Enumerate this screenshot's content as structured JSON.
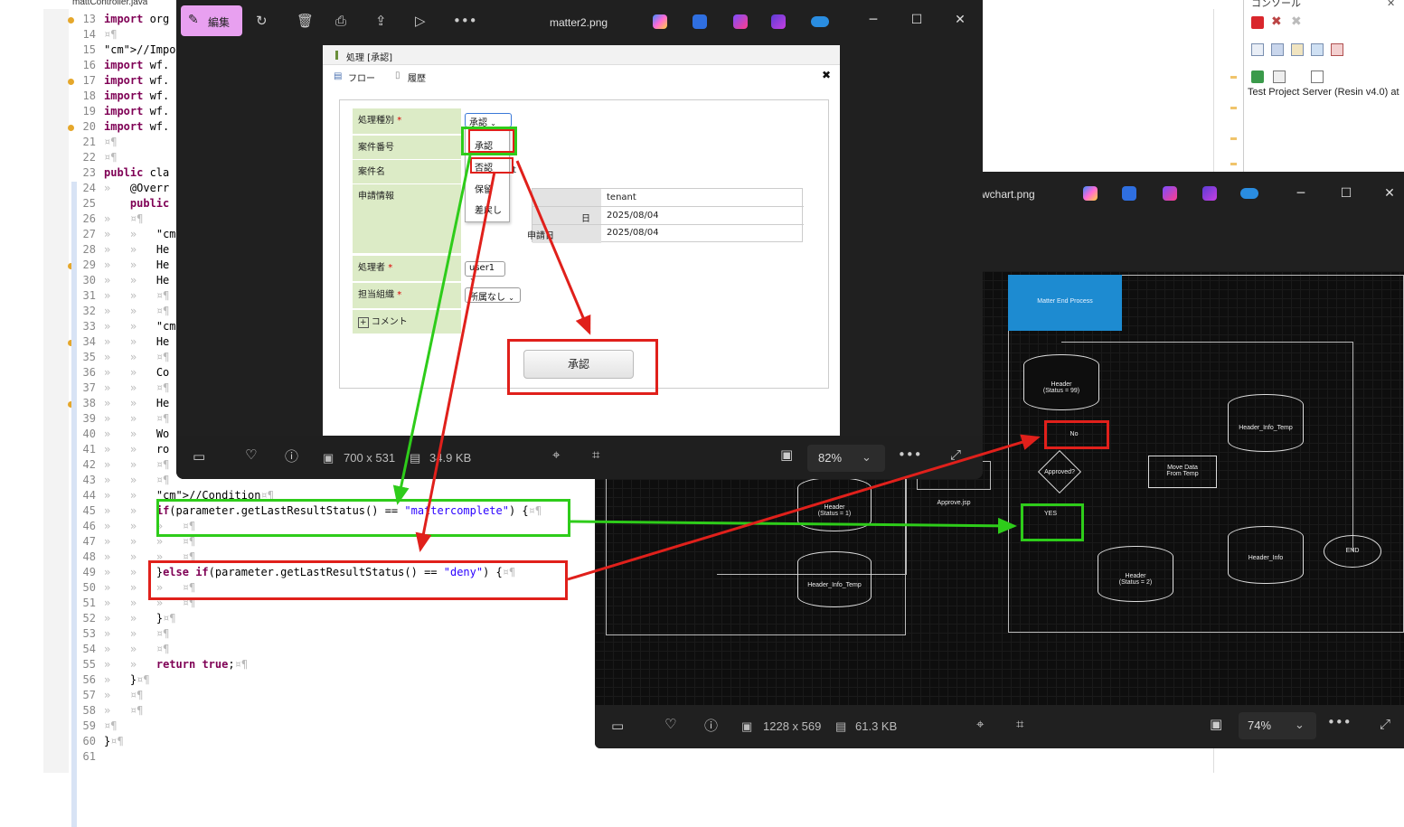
{
  "editor": {
    "tab_title": "mattController.java",
    "lines": [
      {
        "num": "13",
        "text": "import org"
      },
      {
        "num": "14",
        "text": "¤¶"
      },
      {
        "num": "15",
        "text": "//Import a"
      },
      {
        "num": "16",
        "text": "import wf."
      },
      {
        "num": "17",
        "text": "import wf."
      },
      {
        "num": "18",
        "text": "import wf."
      },
      {
        "num": "19",
        "text": "import wf."
      },
      {
        "num": "20",
        "text": "import wf."
      },
      {
        "num": "21",
        "text": "¤¶"
      },
      {
        "num": "22",
        "text": "¤¶"
      },
      {
        "num": "23",
        "text": "public cla"
      },
      {
        "num": "24",
        "text": "»   @Overr"
      },
      {
        "num": "25",
        "text": "    public"
      },
      {
        "num": "26",
        "text": "»   ¤¶"
      },
      {
        "num": "27",
        "text": "»   »   //"
      },
      {
        "num": "28",
        "text": "»   »   He"
      },
      {
        "num": "29",
        "text": "»   »   He"
      },
      {
        "num": "30",
        "text": "»   »   He"
      },
      {
        "num": "31",
        "text": "»   »   ¤¶"
      },
      {
        "num": "32",
        "text": "»   »   ¤¶"
      },
      {
        "num": "33",
        "text": "»   »   //"
      },
      {
        "num": "34",
        "text": "»   »   He"
      },
      {
        "num": "35",
        "text": "»   »   ¤¶"
      },
      {
        "num": "36",
        "text": "»   »   Co"
      },
      {
        "num": "37",
        "text": "»   »   ¤¶"
      },
      {
        "num": "38",
        "text": "»   »   He"
      },
      {
        "num": "39",
        "text": "»   »   ¤¶"
      },
      {
        "num": "40",
        "text": "»   »   Wo"
      },
      {
        "num": "41",
        "text": "»   »   ro"
      },
      {
        "num": "42",
        "text": "»   »   ¤¶"
      },
      {
        "num": "43",
        "text": "»   »   ¤¶"
      },
      {
        "num": "44",
        "text": "»   »   //Condition¤¶"
      },
      {
        "num": "45",
        "text": "»   »   if(parameter.getLastResultStatus() == \"mattercomplete\") {¤¶"
      },
      {
        "num": "46",
        "text": "»   »   »   ¤¶"
      },
      {
        "num": "47",
        "text": "»   »   »   ¤¶"
      },
      {
        "num": "48",
        "text": "»   »   »   ¤¶"
      },
      {
        "num": "49",
        "text": "»   »   }else if(parameter.getLastResultStatus() == \"deny\") {¤¶"
      },
      {
        "num": "50",
        "text": "»   »   »   ¤¶"
      },
      {
        "num": "51",
        "text": "»   »   »   ¤¶"
      },
      {
        "num": "52",
        "text": "»   »   }¤¶"
      },
      {
        "num": "53",
        "text": "»   »   ¤¶"
      },
      {
        "num": "54",
        "text": "»   »   ¤¶"
      },
      {
        "num": "55",
        "text": "»   »   return true;¤¶"
      },
      {
        "num": "56",
        "text": "»   }¤¶"
      },
      {
        "num": "57",
        "text": "»   ¤¶"
      },
      {
        "num": "58",
        "text": "»   ¤¶"
      },
      {
        "num": "59",
        "text": "¤¶"
      },
      {
        "num": "60",
        "text": "}¤¶"
      },
      {
        "num": "61",
        "text": ""
      }
    ]
  },
  "right_panel": {
    "tab_label": "コンソール",
    "server_label": "Test Project Server (Resin v4.0) at"
  },
  "viewer1": {
    "edit_label": "編集",
    "title": "matter2.png",
    "dimensions": "700 x 531",
    "filesize": "34.9 KB",
    "zoom": "82%",
    "form": {
      "header": "処理 [承認]",
      "tab_flow": "フロー",
      "tab_history": "履歴",
      "close": "✖",
      "label_type": "処理種別",
      "label_case_no": "案件番号",
      "label_case_name": "案件名",
      "label_apply": "申請情報",
      "label_processor": "処理者",
      "label_org": "担当組織",
      "label_comment": "コメント",
      "type_value": "承認",
      "dropdown_options": [
        "承認",
        "否認",
        "保留",
        "差戻し"
      ],
      "case_name_tail": "t",
      "apply_rows": [
        {
          "label": "",
          "value": "tenant"
        },
        {
          "label": "日",
          "value": "2025/08/04"
        },
        {
          "label": "申請日",
          "value": "2025/08/04"
        }
      ],
      "processor_value": "user1",
      "org_value": "所属なし",
      "submit": "承認",
      "required_mark": "*"
    }
  },
  "viewer2": {
    "title": "wchart.png",
    "dimensions": "1228 x 569",
    "filesize": "61.3 KB",
    "zoom": "74%",
    "flow": {
      "end_process": "Matter End Process",
      "header99": "Header\n(Status = 99)",
      "no": "No",
      "approved": "Approved?",
      "yes": "YES",
      "header_info_temp_right": "Header_Info_Temp",
      "move_data": "Move Data\nFrom Temp",
      "header_info": "Header_Info",
      "end": "END",
      "header2": "Header\n(Status = 2)",
      "header1": "Header\n(Status = 1)",
      "header_info_temp_left": "Header_Info_Temp",
      "approve_jsp": "Approve.jsp"
    }
  },
  "colors": {
    "green": "#2ecc1a",
    "red": "#e0201b",
    "accent": "#e8a0f0"
  }
}
